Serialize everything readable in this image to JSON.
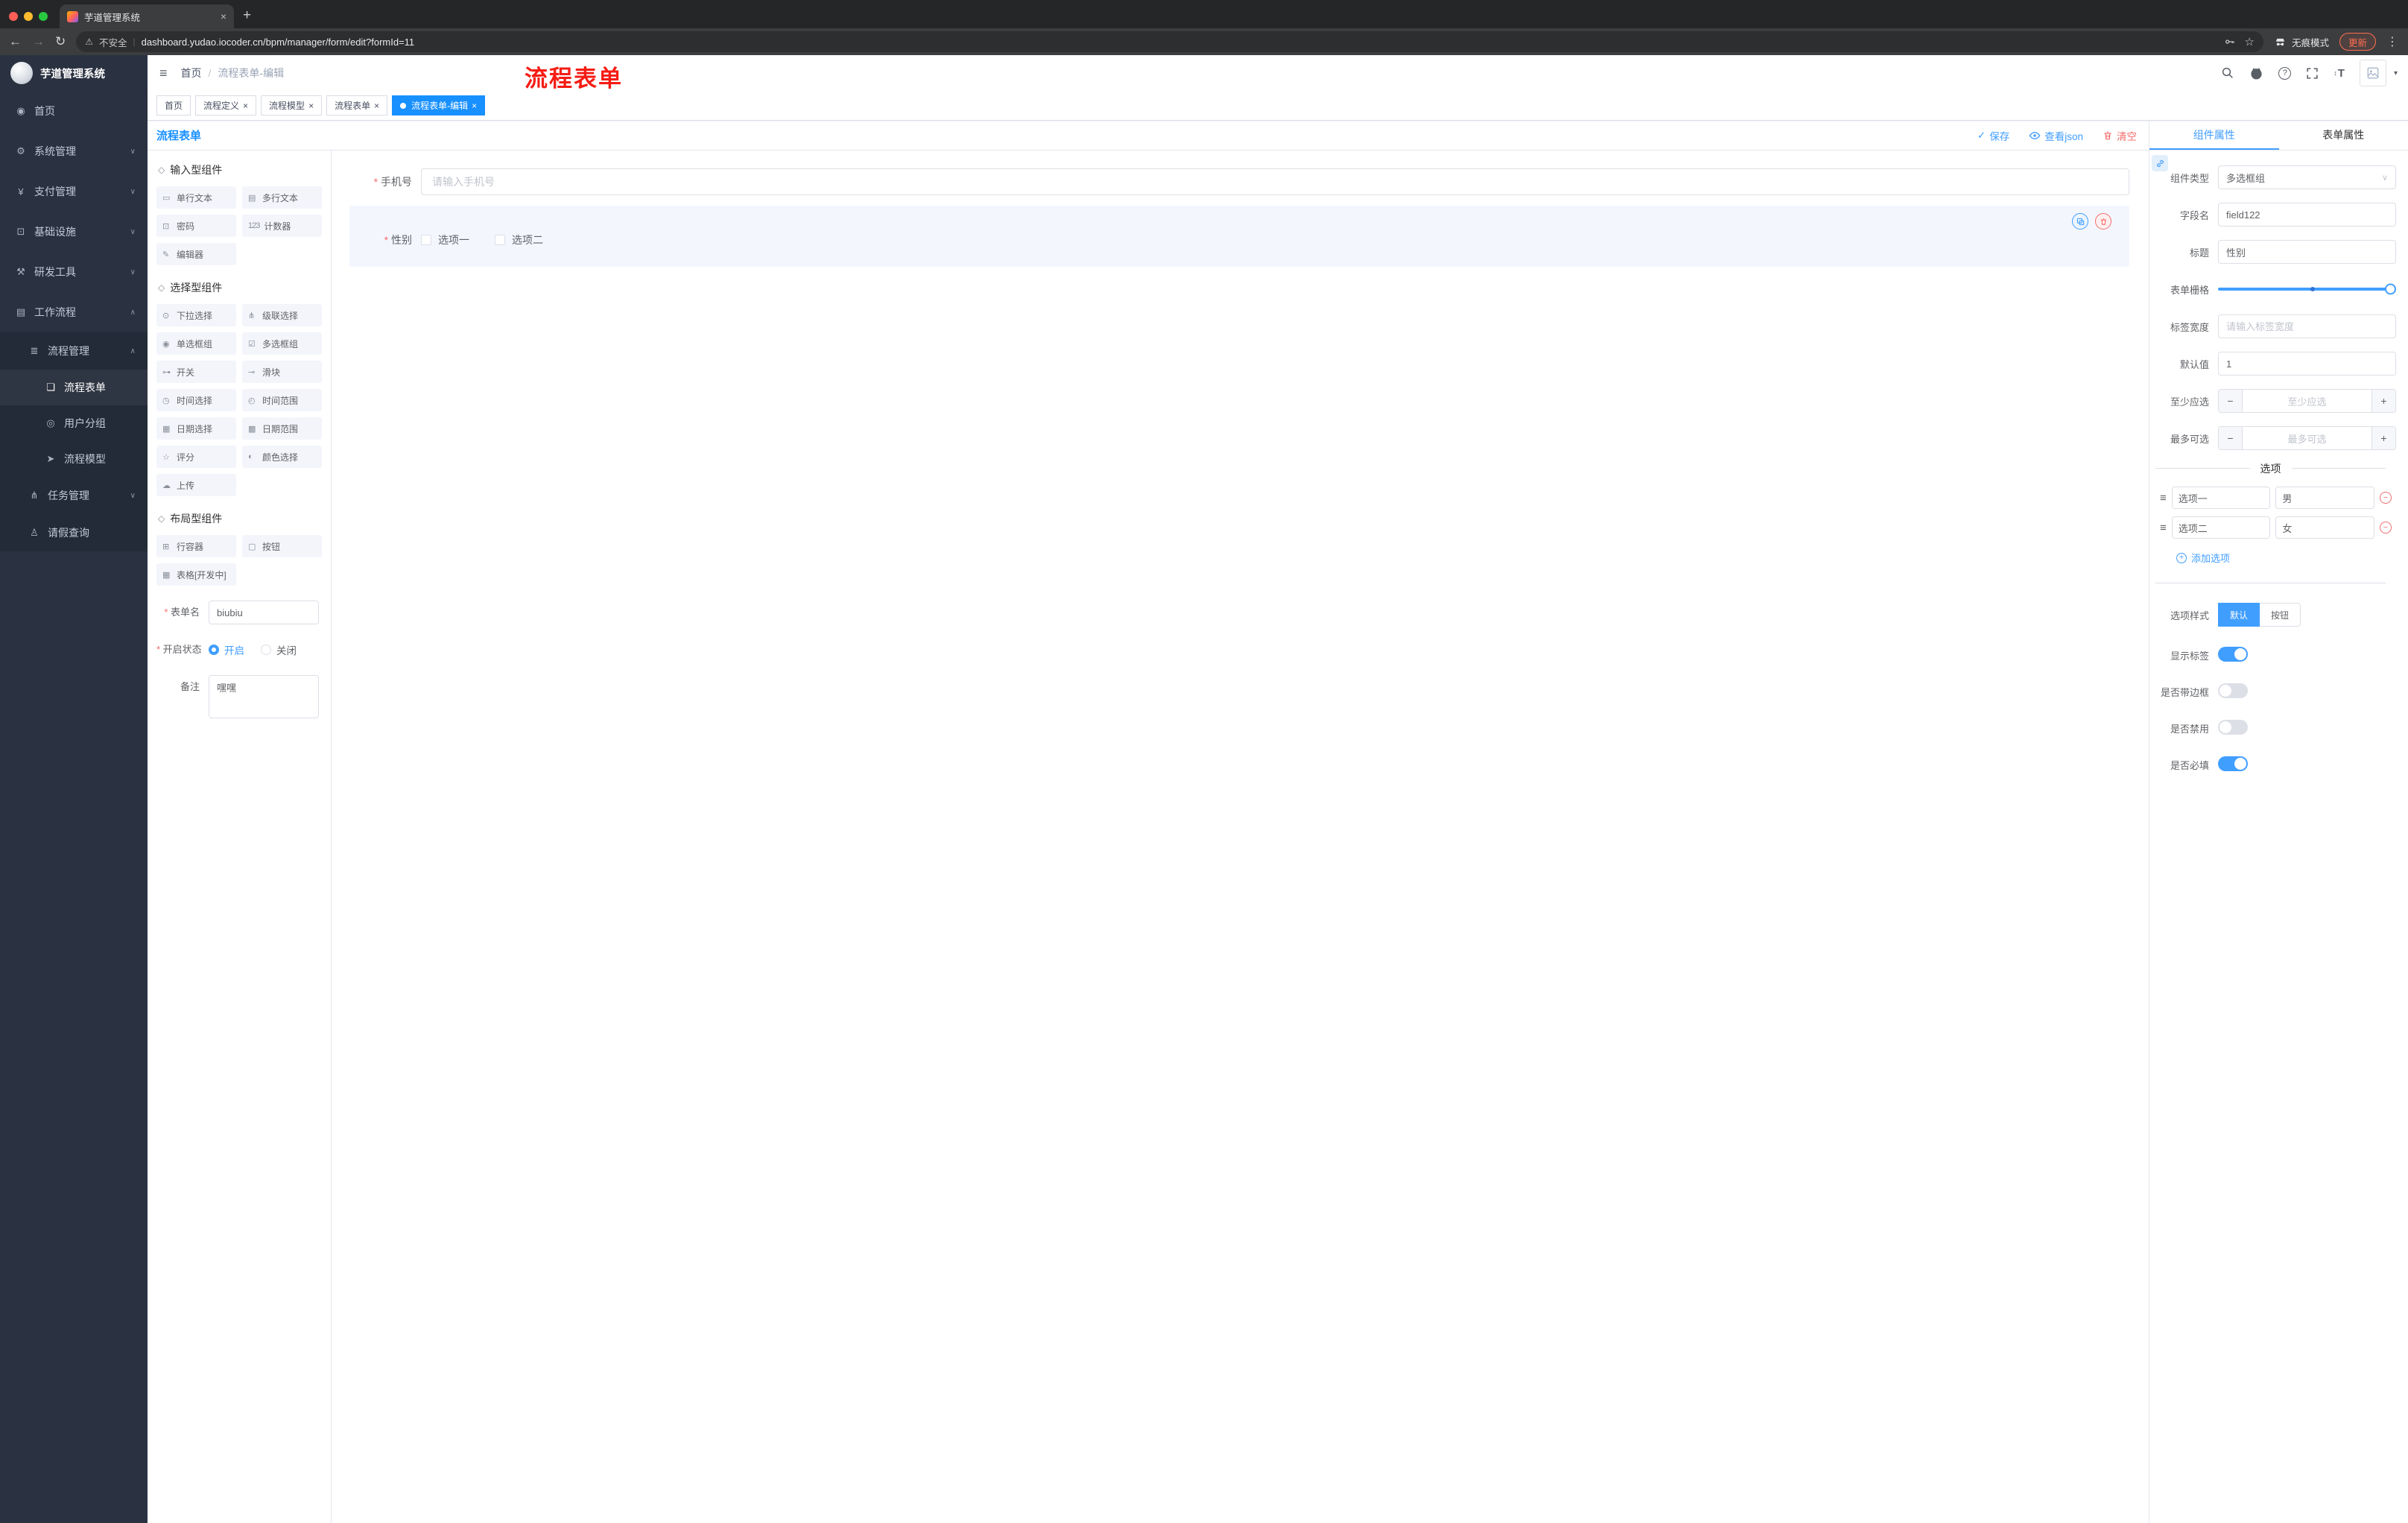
{
  "annotation": {
    "text": "流程表单"
  },
  "icons": {
    "hamburger": "≡",
    "back": "←",
    "forward": "→",
    "reload": "↻",
    "warning": "⚠",
    "star": "☆",
    "new_tab": "+",
    "kebab": "⋮",
    "close": "×",
    "check": "✓",
    "chevron_down": "∨",
    "caret_down": "▾",
    "minus": "−",
    "plus": "+",
    "pipe": "|",
    "section_cube": "◇",
    "drag_handle": "≡",
    "font_size_T": "T",
    "font_size_arrows": "↕"
  },
  "browser": {
    "tab_title": "芋道管理系统",
    "security_label": "不安全",
    "url": "dashboard.yudao.iocoder.cn/bpm/manager/form/edit?formId=11",
    "incognito_label": "无痕模式",
    "update_label": "更新"
  },
  "sidebar": {
    "logo_title": "芋道管理系统",
    "menu": [
      {
        "label": "首页",
        "glyph": "◉"
      },
      {
        "label": "系统管理",
        "glyph": "⚙",
        "arrow": "∨"
      },
      {
        "label": "支付管理",
        "glyph": "¥",
        "arrow": "∨"
      },
      {
        "label": "基础设施",
        "glyph": "⊡",
        "arrow": "∨"
      },
      {
        "label": "研发工具",
        "glyph": "⚒",
        "arrow": "∨"
      },
      {
        "label": "工作流程",
        "glyph": "▤",
        "arrow": "∧",
        "open": true
      }
    ],
    "process": {
      "label": "流程管理",
      "glyph": "≣",
      "arrow": "∧",
      "children": [
        {
          "label": "流程表单",
          "glyph": "❏",
          "active": true
        },
        {
          "label": "用户分组",
          "glyph": "◎"
        },
        {
          "label": "流程模型",
          "glyph": "➤"
        }
      ]
    },
    "tail": [
      {
        "label": "任务管理",
        "glyph": "⋔",
        "arrow": "∨"
      },
      {
        "label": "请假查询",
        "glyph": "♙"
      }
    ]
  },
  "header": {
    "breadcrumb_home": "首页",
    "breadcrumb_sep": "/",
    "breadcrumb_current": "流程表单-编辑"
  },
  "tabsbar": [
    {
      "label": "首页"
    },
    {
      "label": "流程定义",
      "closable": true
    },
    {
      "label": "流程模型",
      "closable": true
    },
    {
      "label": "流程表单",
      "closable": true
    },
    {
      "label": "流程表单-编辑",
      "closable": true,
      "active": true
    }
  ],
  "designer": {
    "title": "流程表单",
    "save_label": "保存",
    "view_json_label": "查看json",
    "clear_label": "清空",
    "palette": {
      "sections": [
        {
          "title": "输入型组件",
          "items": [
            {
              "label": "单行文本",
              "glyph": "▭"
            },
            {
              "label": "多行文本",
              "glyph": "▤"
            },
            {
              "label": "密码",
              "glyph": "⊡"
            },
            {
              "label": "计数器",
              "glyph": "123"
            },
            {
              "label": "编辑器",
              "glyph": "✎"
            }
          ]
        },
        {
          "title": "选择型组件",
          "items": [
            {
              "label": "下拉选择",
              "glyph": "⊙"
            },
            {
              "label": "级联选择",
              "glyph": "⋔"
            },
            {
              "label": "单选框组",
              "glyph": "◉"
            },
            {
              "label": "多选框组",
              "glyph": "☑"
            },
            {
              "label": "开关",
              "glyph": "⊶"
            },
            {
              "label": "滑块",
              "glyph": "⊸"
            },
            {
              "label": "时间选择",
              "glyph": "◷"
            },
            {
              "label": "时间范围",
              "glyph": "◴"
            },
            {
              "label": "日期选择",
              "glyph": "▦"
            },
            {
              "label": "日期范围",
              "glyph": "▩"
            },
            {
              "label": "评分",
              "glyph": "☆"
            },
            {
              "label": "颜色选择",
              "glyph": "◐"
            },
            {
              "label": "上传",
              "glyph": "☁"
            }
          ]
        },
        {
          "title": "布局型组件",
          "items": [
            {
              "label": "行容器",
              "glyph": "⊞"
            },
            {
              "label": "按钮",
              "glyph": "▢"
            },
            {
              "label": "表格[开发中]",
              "glyph": "▦"
            }
          ]
        }
      ],
      "form": {
        "name_label": "表单名",
        "name_value": "biubiu",
        "status_label": "开启状态",
        "status_on": "开启",
        "status_off": "关闭",
        "remark_label": "备注",
        "remark_value": "嘿嘿"
      }
    },
    "canvas": {
      "phone_label": "手机号",
      "phone_placeholder": "请输入手机号",
      "gender_label": "性别",
      "gender_options": [
        {
          "label": "选项一"
        },
        {
          "label": "选项二"
        }
      ]
    }
  },
  "props": {
    "tab_component": "组件属性",
    "tab_form": "表单属性",
    "type_label": "组件类型",
    "type_value": "多选框组",
    "field_label": "字段名",
    "field_value": "field122",
    "title_label": "标题",
    "title_value": "性别",
    "grid_label": "表单栅格",
    "labelwidth_label": "标签宽度",
    "labelwidth_placeholder": "请输入标签宽度",
    "default_label": "默认值",
    "default_value": "1",
    "min_label": "至少应选",
    "min_placeholder": "至少应选",
    "max_label": "最多可选",
    "max_placeholder": "最多可选",
    "options_title": "选项",
    "options": [
      {
        "label": "选项一",
        "value": "男"
      },
      {
        "label": "选项二",
        "value": "女"
      }
    ],
    "add_option_label": "添加选项",
    "style_label": "选项样式",
    "style_options": [
      {
        "label": "默认",
        "active": true
      },
      {
        "label": "按钮"
      }
    ],
    "switches": [
      {
        "label": "显示标签",
        "on": true
      },
      {
        "label": "是否带边框"
      },
      {
        "label": "是否禁用"
      },
      {
        "label": "是否必填",
        "on": true
      }
    ]
  }
}
